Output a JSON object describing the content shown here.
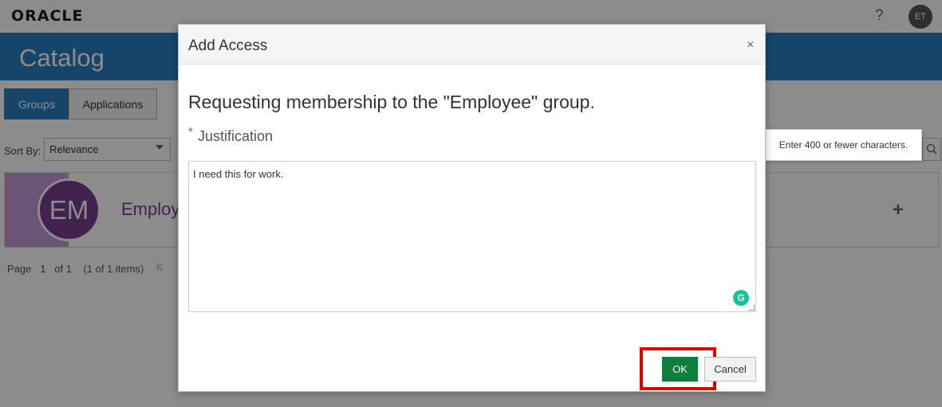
{
  "header": {
    "logo_text": "ORACLE",
    "help_label": "?",
    "user_initials": "ET"
  },
  "banner": {
    "title": "Catalog"
  },
  "tabs": [
    {
      "label": "Groups",
      "active": true
    },
    {
      "label": "Applications",
      "active": false
    }
  ],
  "sort": {
    "label": "Sort By:",
    "value": "Relevance"
  },
  "card": {
    "initials": "EM",
    "name_visible": "Employe",
    "add_label": "+"
  },
  "pager": {
    "page_label": "Page",
    "page": "1",
    "of_label": "of 1",
    "items": "(1 of 1 items)",
    "first_symbol": "K"
  },
  "dialog": {
    "title": "Add Access",
    "close_label": "×",
    "heading": "Requesting membership to the \"Employee\" group.",
    "required_marker": "*",
    "field_label": "Justification",
    "field_value": "I need this for work.",
    "tooltip": "Enter 400 or fewer characters.",
    "ok_label": "OK",
    "cancel_label": "Cancel"
  },
  "colors": {
    "brand_blue": "#2a7fc0",
    "ok_green": "#0d7f3a",
    "highlight_red": "#e00000",
    "avatar_purple": "#7a3f93"
  }
}
